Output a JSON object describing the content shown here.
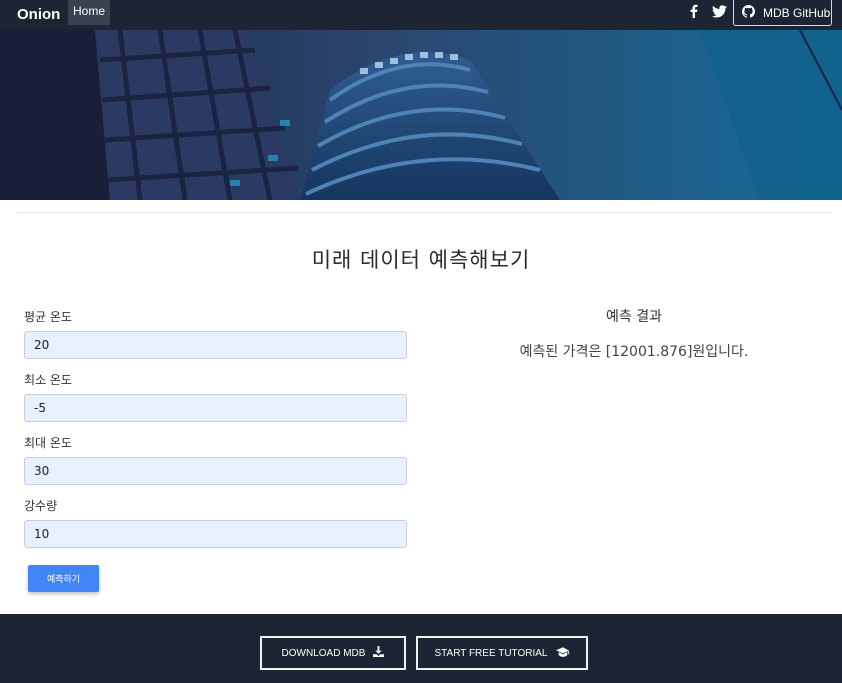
{
  "navbar": {
    "brand": "Onion",
    "home_label": "Home",
    "facebook_icon": "facebook-icon",
    "twitter_icon": "twitter-icon",
    "github_label": "MDB GitHub",
    "github_icon": "github-icon"
  },
  "hero": {
    "image": "building-photo"
  },
  "main": {
    "title": "미래 데이터 예측해보기",
    "fields": [
      {
        "label": "평균 온도",
        "value": "20"
      },
      {
        "label": "최소 온도",
        "value": "-5"
      },
      {
        "label": "최대 온도",
        "value": "30"
      },
      {
        "label": "강수량",
        "value": "10"
      }
    ],
    "submit_label": "예측하기"
  },
  "result": {
    "title": "예측 결과",
    "text": "예측된 가격은 [12001.876]원입니다."
  },
  "footer": {
    "download_label": "DOWNLOAD MDB",
    "download_icon": "download-icon",
    "tutorial_label": "START FREE TUTORIAL",
    "tutorial_icon": "graduation-cap-icon"
  },
  "colors": {
    "navbar_bg": "#1d2433",
    "input_bg": "#e8f0fe",
    "button_primary": "#4285f4"
  }
}
